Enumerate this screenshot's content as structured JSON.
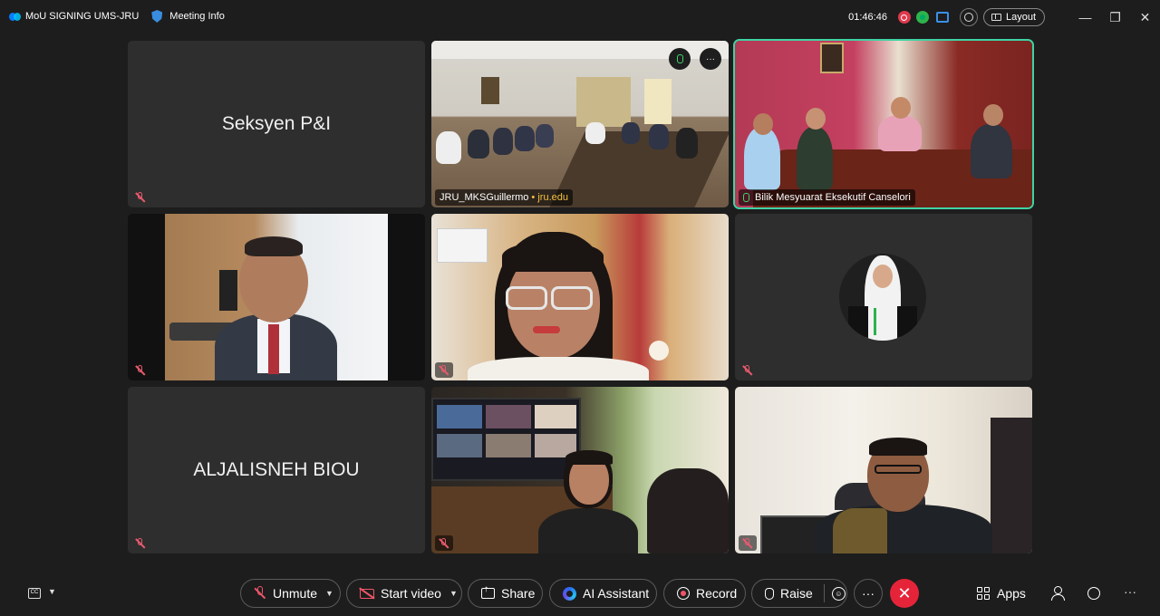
{
  "topbar": {
    "meeting_title": "MoU SIGNING UMS-JRU",
    "meeting_info": "Meeting Info",
    "time": "01:46:46",
    "layout_label": "Layout",
    "minimize_icon": "—",
    "restore_icon": "❐",
    "close_icon": "✕"
  },
  "tiles": {
    "seksyen": {
      "name": "Seksyen P&I"
    },
    "jru": {
      "label": "JRU_MKSGuillermo",
      "domain": "jru.edu"
    },
    "bilik": {
      "label": "Bilik Mesyuarat Eksekutif Canselori"
    },
    "aljalisneh": {
      "name": "ALJALISNEH BIOU"
    }
  },
  "controls": {
    "cc_text": "CC",
    "unmute": "Unmute",
    "start_video": "Start video",
    "share": "Share",
    "ai_assistant": "AI Assistant",
    "record": "Record",
    "raise": "Raise",
    "more": "···",
    "leave": "✕",
    "apps": "Apps",
    "overflow": "···"
  },
  "colors": {
    "background": "#1d1d1d",
    "tile": "#2e2e2e",
    "active_border": "#3fd3a4",
    "muted_red": "#e85a6e",
    "leave_red": "#e5243a"
  }
}
